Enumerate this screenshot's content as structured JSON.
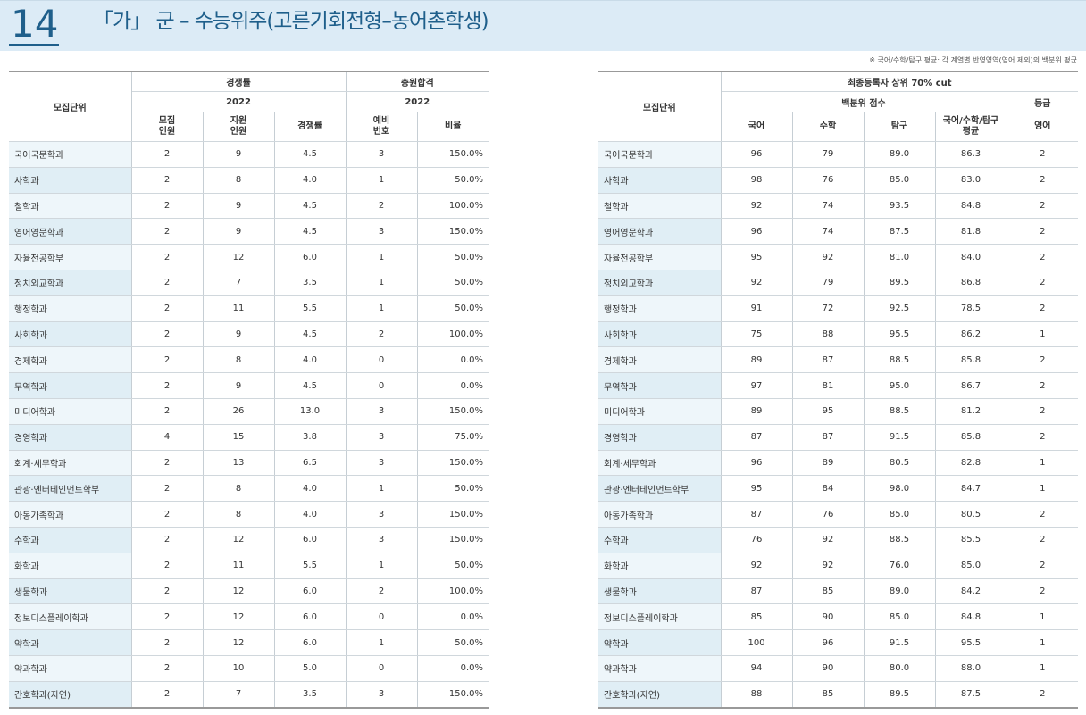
{
  "header": {
    "page_number": "14",
    "title": "「가」 군 – 수능위주(고른기회전형–농어촌학생)"
  },
  "note": "※ 국어/수학/탐구 평균: 각 계열별 반영영역(영어 제외)의 백분위 평균",
  "left_table": {
    "headers": {
      "unit": "모집단위",
      "competition": "경쟁률",
      "additional": "충원합격",
      "year_a": "2022",
      "year_b": "2022",
      "quota": "모집\n인원",
      "applicants": "지원\n인원",
      "ratio": "경쟁률",
      "waitlist": "예비\n번호",
      "rate": "비율"
    },
    "rows": [
      {
        "name": "국어국문학과",
        "quota": "2",
        "applicants": "9",
        "ratio": "4.5",
        "waitlist": "3",
        "rate": "150.0%"
      },
      {
        "name": "사학과",
        "quota": "2",
        "applicants": "8",
        "ratio": "4.0",
        "waitlist": "1",
        "rate": "50.0%"
      },
      {
        "name": "철학과",
        "quota": "2",
        "applicants": "9",
        "ratio": "4.5",
        "waitlist": "2",
        "rate": "100.0%"
      },
      {
        "name": "영어영문학과",
        "quota": "2",
        "applicants": "9",
        "ratio": "4.5",
        "waitlist": "3",
        "rate": "150.0%"
      },
      {
        "name": "자율전공학부",
        "quota": "2",
        "applicants": "12",
        "ratio": "6.0",
        "waitlist": "1",
        "rate": "50.0%"
      },
      {
        "name": "정치외교학과",
        "quota": "2",
        "applicants": "7",
        "ratio": "3.5",
        "waitlist": "1",
        "rate": "50.0%"
      },
      {
        "name": "행정학과",
        "quota": "2",
        "applicants": "11",
        "ratio": "5.5",
        "waitlist": "1",
        "rate": "50.0%"
      },
      {
        "name": "사회학과",
        "quota": "2",
        "applicants": "9",
        "ratio": "4.5",
        "waitlist": "2",
        "rate": "100.0%"
      },
      {
        "name": "경제학과",
        "quota": "2",
        "applicants": "8",
        "ratio": "4.0",
        "waitlist": "0",
        "rate": "0.0%"
      },
      {
        "name": "무역학과",
        "quota": "2",
        "applicants": "9",
        "ratio": "4.5",
        "waitlist": "0",
        "rate": "0.0%"
      },
      {
        "name": "미디어학과",
        "quota": "2",
        "applicants": "26",
        "ratio": "13.0",
        "waitlist": "3",
        "rate": "150.0%"
      },
      {
        "name": "경영학과",
        "quota": "4",
        "applicants": "15",
        "ratio": "3.8",
        "waitlist": "3",
        "rate": "75.0%"
      },
      {
        "name": "회계·세무학과",
        "quota": "2",
        "applicants": "13",
        "ratio": "6.5",
        "waitlist": "3",
        "rate": "150.0%"
      },
      {
        "name": "관광·엔터테인먼트학부",
        "quota": "2",
        "applicants": "8",
        "ratio": "4.0",
        "waitlist": "1",
        "rate": "50.0%"
      },
      {
        "name": "아동가족학과",
        "quota": "2",
        "applicants": "8",
        "ratio": "4.0",
        "waitlist": "3",
        "rate": "150.0%"
      },
      {
        "name": "수학과",
        "quota": "2",
        "applicants": "12",
        "ratio": "6.0",
        "waitlist": "3",
        "rate": "150.0%"
      },
      {
        "name": "화학과",
        "quota": "2",
        "applicants": "11",
        "ratio": "5.5",
        "waitlist": "1",
        "rate": "50.0%"
      },
      {
        "name": "생물학과",
        "quota": "2",
        "applicants": "12",
        "ratio": "6.0",
        "waitlist": "2",
        "rate": "100.0%"
      },
      {
        "name": "정보디스플레이학과",
        "quota": "2",
        "applicants": "12",
        "ratio": "6.0",
        "waitlist": "0",
        "rate": "0.0%"
      },
      {
        "name": "약학과",
        "quota": "2",
        "applicants": "12",
        "ratio": "6.0",
        "waitlist": "1",
        "rate": "50.0%"
      },
      {
        "name": "약과학과",
        "quota": "2",
        "applicants": "10",
        "ratio": "5.0",
        "waitlist": "0",
        "rate": "0.0%"
      },
      {
        "name": "간호학과(자연)",
        "quota": "2",
        "applicants": "7",
        "ratio": "3.5",
        "waitlist": "3",
        "rate": "150.0%"
      }
    ]
  },
  "right_table": {
    "headers": {
      "unit": "모집단위",
      "cut": "최종등록자 상위 70% cut",
      "percentile": "백분위 점수",
      "grade": "등급",
      "korean": "국어",
      "math": "수학",
      "inquiry": "탐구",
      "average": "국어/수학/탐구\n평균",
      "english": "영어"
    },
    "rows": [
      {
        "name": "국어국문학과",
        "korean": "96",
        "math": "79",
        "inquiry": "89.0",
        "average": "86.3",
        "english": "2"
      },
      {
        "name": "사학과",
        "korean": "98",
        "math": "76",
        "inquiry": "85.0",
        "average": "83.0",
        "english": "2"
      },
      {
        "name": "철학과",
        "korean": "92",
        "math": "74",
        "inquiry": "93.5",
        "average": "84.8",
        "english": "2"
      },
      {
        "name": "영어영문학과",
        "korean": "96",
        "math": "74",
        "inquiry": "87.5",
        "average": "81.8",
        "english": "2"
      },
      {
        "name": "자율전공학부",
        "korean": "95",
        "math": "92",
        "inquiry": "81.0",
        "average": "84.0",
        "english": "2"
      },
      {
        "name": "정치외교학과",
        "korean": "92",
        "math": "79",
        "inquiry": "89.5",
        "average": "86.8",
        "english": "2"
      },
      {
        "name": "행정학과",
        "korean": "91",
        "math": "72",
        "inquiry": "92.5",
        "average": "78.5",
        "english": "2"
      },
      {
        "name": "사회학과",
        "korean": "75",
        "math": "88",
        "inquiry": "95.5",
        "average": "86.2",
        "english": "1"
      },
      {
        "name": "경제학과",
        "korean": "89",
        "math": "87",
        "inquiry": "88.5",
        "average": "85.8",
        "english": "2"
      },
      {
        "name": "무역학과",
        "korean": "97",
        "math": "81",
        "inquiry": "95.0",
        "average": "86.7",
        "english": "2"
      },
      {
        "name": "미디어학과",
        "korean": "89",
        "math": "95",
        "inquiry": "88.5",
        "average": "81.2",
        "english": "2"
      },
      {
        "name": "경영학과",
        "korean": "87",
        "math": "87",
        "inquiry": "91.5",
        "average": "85.8",
        "english": "2"
      },
      {
        "name": "회계·세무학과",
        "korean": "96",
        "math": "89",
        "inquiry": "80.5",
        "average": "82.8",
        "english": "1"
      },
      {
        "name": "관광·엔터테인먼트학부",
        "korean": "95",
        "math": "84",
        "inquiry": "98.0",
        "average": "84.7",
        "english": "1"
      },
      {
        "name": "아동가족학과",
        "korean": "87",
        "math": "76",
        "inquiry": "85.0",
        "average": "80.5",
        "english": "2"
      },
      {
        "name": "수학과",
        "korean": "76",
        "math": "92",
        "inquiry": "88.5",
        "average": "85.5",
        "english": "2"
      },
      {
        "name": "화학과",
        "korean": "92",
        "math": "92",
        "inquiry": "76.0",
        "average": "85.0",
        "english": "2"
      },
      {
        "name": "생물학과",
        "korean": "87",
        "math": "85",
        "inquiry": "89.0",
        "average": "84.2",
        "english": "2"
      },
      {
        "name": "정보디스플레이학과",
        "korean": "85",
        "math": "90",
        "inquiry": "85.0",
        "average": "84.8",
        "english": "1"
      },
      {
        "name": "약학과",
        "korean": "100",
        "math": "96",
        "inquiry": "91.5",
        "average": "95.5",
        "english": "1"
      },
      {
        "name": "약과학과",
        "korean": "94",
        "math": "90",
        "inquiry": "80.0",
        "average": "88.0",
        "english": "1"
      },
      {
        "name": "간호학과(자연)",
        "korean": "88",
        "math": "85",
        "inquiry": "89.5",
        "average": "87.5",
        "english": "2"
      }
    ]
  }
}
